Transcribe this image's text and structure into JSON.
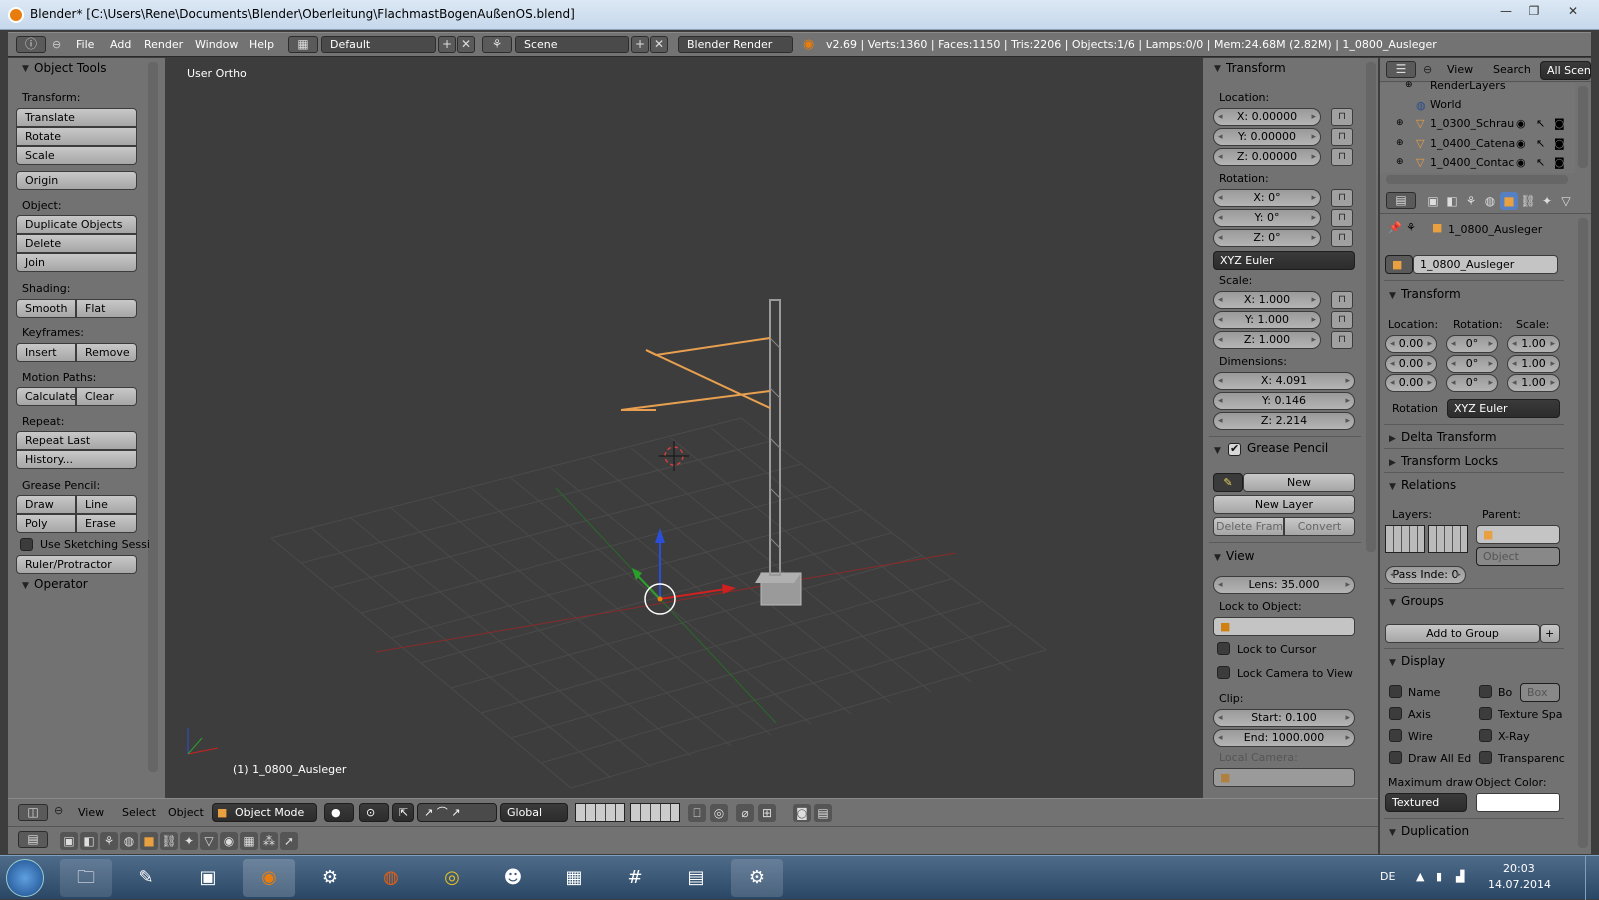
{
  "window": {
    "title": "Blender* [C:\\Users\\Rene\\Documents\\Blender\\Oberleitung\\FlachmastBogenAußenOS.blend]",
    "min": "—",
    "max": "❐",
    "close": "✕"
  },
  "info_header": {
    "menus": [
      "File",
      "Add",
      "Render",
      "Window",
      "Help"
    ],
    "layout": "Default",
    "scene": "Scene",
    "engine": "Blender Render",
    "stats": "v2.69 | Verts:1360 | Faces:1150 | Tris:2206 | Objects:1/6 | Lamps:0/0 | Mem:24.68M (2.82M) | 1_0800_Ausleger"
  },
  "tool_shelf": {
    "title": "Object Tools",
    "transform_label": "Transform:",
    "translate": "Translate",
    "rotate": "Rotate",
    "scale": "Scale",
    "origin": "Origin",
    "object_label": "Object:",
    "duplicate": "Duplicate Objects",
    "delete": "Delete",
    "join": "Join",
    "shading_label": "Shading:",
    "smooth": "Smooth",
    "flat": "Flat",
    "keyframes_label": "Keyframes:",
    "insert": "Insert",
    "remove": "Remove",
    "motion_label": "Motion Paths:",
    "calculate": "Calculate",
    "clear": "Clear",
    "repeat_label": "Repeat:",
    "repeat_last": "Repeat Last",
    "history": "History...",
    "grease_label": "Grease Pencil:",
    "draw": "Draw",
    "line": "Line",
    "poly": "Poly",
    "erase": "Erase",
    "sketching": "Use Sketching Sessi",
    "ruler": "Ruler/Protractor",
    "operator": "Operator"
  },
  "viewport": {
    "view_name": "User Ortho",
    "object_label": "(1) 1_0800_Ausleger"
  },
  "n_panel": {
    "transform_title": "Transform",
    "location_label": "Location:",
    "loc": [
      "X: 0.00000",
      "Y: 0.00000",
      "Z: 0.00000"
    ],
    "rotation_label": "Rotation:",
    "rot": [
      "X: 0°",
      "Y: 0°",
      "Z: 0°"
    ],
    "rotation_mode": "XYZ Euler",
    "scale_label": "Scale:",
    "scale": [
      "X: 1.000",
      "Y: 1.000",
      "Z: 1.000"
    ],
    "dimensions_label": "Dimensions:",
    "dims": [
      "X: 4.091",
      "Y: 0.146",
      "Z: 2.214"
    ],
    "grease_title": "Grease Pencil",
    "gp_new": "New",
    "gp_new_layer": "New Layer",
    "gp_delete_frame": "Delete Frame",
    "gp_convert": "Convert",
    "view_title": "View",
    "lens": "Lens: 35.000",
    "lock_to_object": "Lock to Object:",
    "lock_cursor": "Lock to Cursor",
    "lock_camera": "Lock Camera to View",
    "clip_label": "Clip:",
    "clip_start": "Start: 0.100",
    "clip_end": "End: 1000.000",
    "local_camera": "Local Camera:"
  },
  "view3d_header": {
    "menus": [
      "View",
      "Select",
      "Object"
    ],
    "mode": "Object Mode",
    "orientation": "Global"
  },
  "outliner": {
    "header": {
      "view": "View",
      "search": "Search",
      "filter": "All Scene"
    },
    "rows": [
      "RenderLayers",
      "World",
      "1_0300_Schrau",
      "1_0400_Catena",
      "1_0400_Contac"
    ]
  },
  "properties": {
    "breadcrumb": "1_0800_Ausleger",
    "object_name": "1_0800_Ausleger",
    "transform_title": "Transform",
    "col_location": "Location:",
    "col_rotation": "Rotation:",
    "col_scale": "Scale:",
    "loc_vals": [
      "0.00",
      "0.00",
      "0.00"
    ],
    "rot_vals": [
      "0°",
      "0°",
      "0°"
    ],
    "scale_vals": [
      "1.00",
      "1.00",
      "1.00"
    ],
    "rotation_label": "Rotation",
    "rotation_mode": "XYZ Euler",
    "delta_transform": "Delta Transform",
    "transform_locks": "Transform Locks",
    "relations": "Relations",
    "layers_label": "Layers:",
    "parent_label": "Parent:",
    "parent_type": "Object",
    "pass_index": "Pass Inde: 0",
    "groups": "Groups",
    "add_to_group": "Add to Group",
    "display": "Display",
    "name": "Name",
    "bounds": "Bo",
    "bounds_type": "Box",
    "axis": "Axis",
    "texture_space": "Texture Spa",
    "wire": "Wire",
    "xray": "X-Ray",
    "draw_all_edges": "Draw All Ed",
    "transparency": "Transparenc",
    "max_draw_label": "Maximum draw",
    "object_color_label": "Object Color:",
    "max_draw": "Textured",
    "duplication": "Duplication"
  },
  "taskbar": {
    "lang": "DE",
    "time": "20:03",
    "date": "14.07.2014"
  },
  "colors": {
    "accent": "#e87d0d",
    "selected_outline": "#e8a050",
    "panel_bg": "#727272",
    "viewport_bg": "#3d3d3d"
  }
}
